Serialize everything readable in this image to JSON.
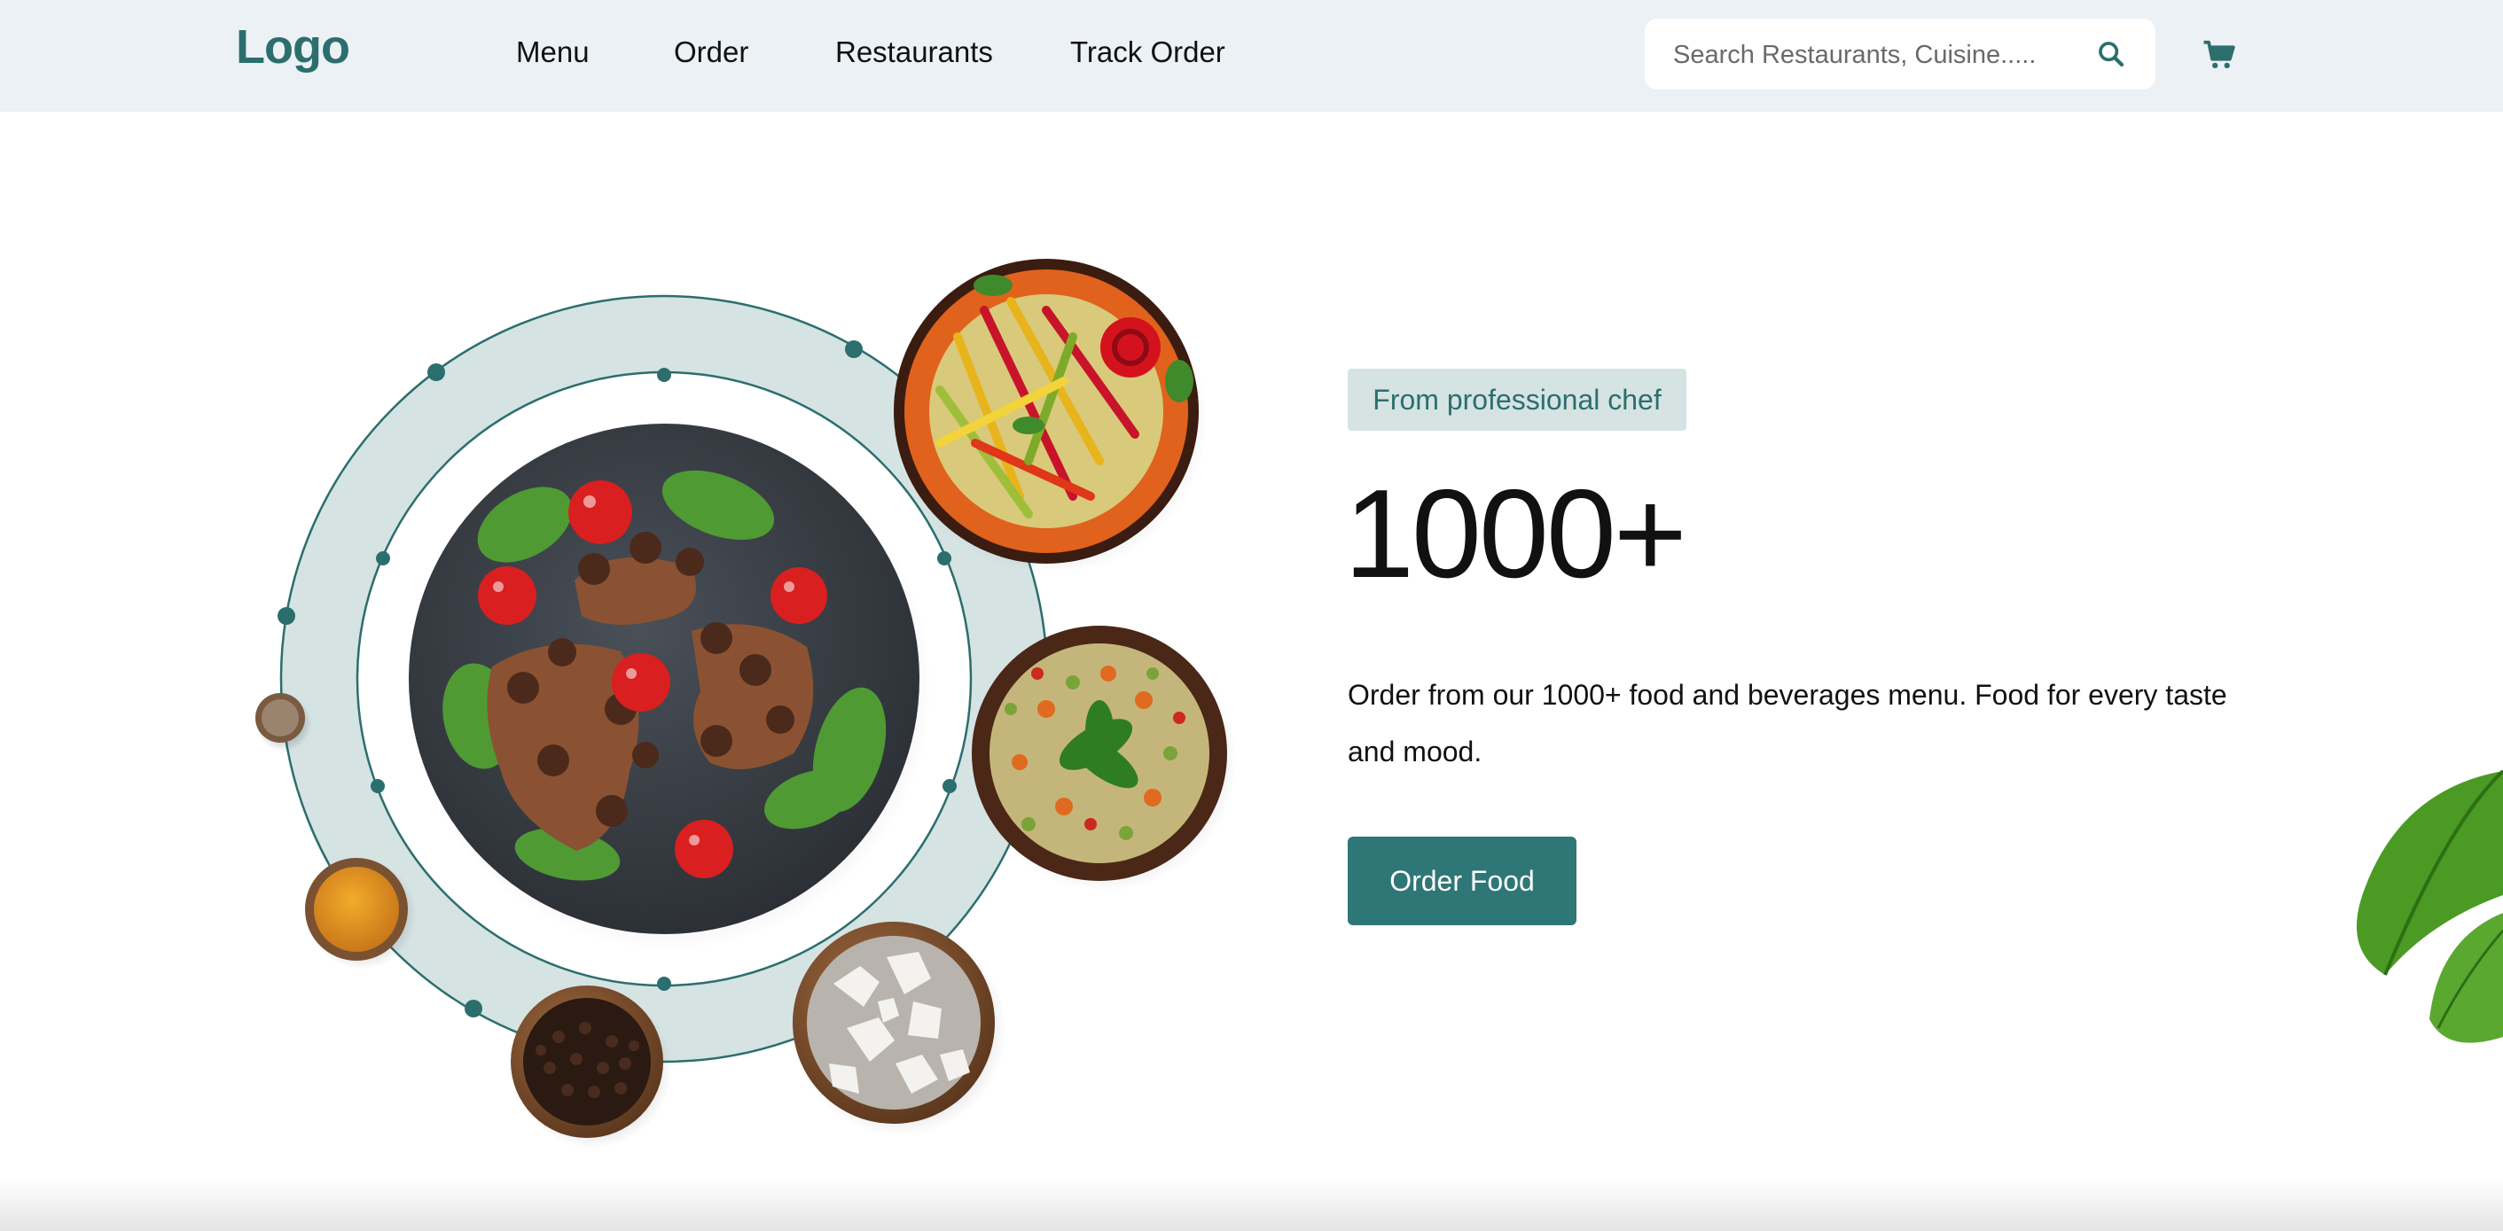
{
  "header": {
    "logo": "Logo",
    "nav": [
      "Menu",
      "Order",
      "Restaurants",
      "Track Order"
    ],
    "search": {
      "placeholder": "Search Restaurants, Cuisine....."
    },
    "icons": {
      "search": "search-icon",
      "cart": "cart-icon"
    }
  },
  "hero": {
    "badge": "From professional chef",
    "headline": "1000+",
    "description": "Order from our 1000+ food and beverages menu. Food for every taste and mood.",
    "cta": "Order Food"
  },
  "colors": {
    "brand": "#2c6e6e",
    "button": "#2f7676",
    "badge_bg": "#d5e3e3",
    "header_bg": "#ecf1f5"
  }
}
